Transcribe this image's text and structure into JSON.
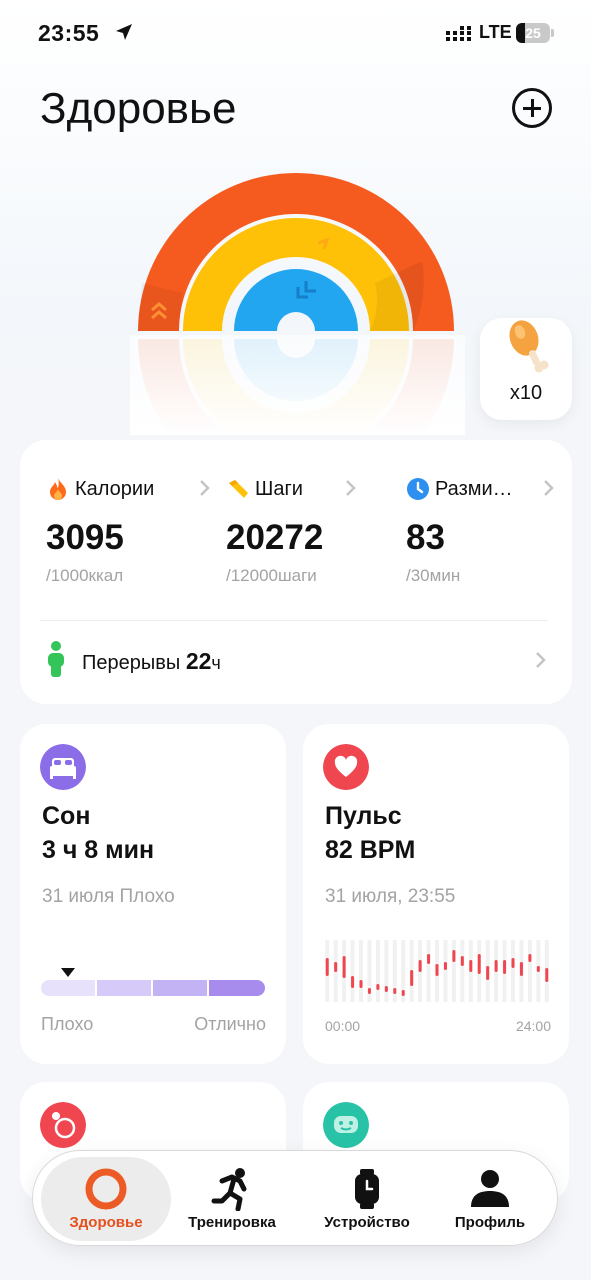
{
  "status_bar": {
    "time": "23:55",
    "network": "LTE",
    "battery": "25",
    "battery_level": 0.25
  },
  "page_title": "Здоровье",
  "rings": {
    "colors": {
      "outer": "#f55a1f",
      "middle": "#ffc107",
      "inner": "#23a6f0"
    }
  },
  "reward": {
    "count": "x10",
    "icon": "drumstick-icon"
  },
  "activity": {
    "metrics": [
      {
        "label": "Калории",
        "value": "3095",
        "goal": "/1000ккал",
        "icon": "flame-icon",
        "color": "#ff6a1a"
      },
      {
        "label": "Шаги",
        "value": "20272",
        "goal": "/12000шаги",
        "icon": "shoe-icon",
        "color": "#ffc107"
      },
      {
        "label": "Разми…",
        "value": "83",
        "goal": "/30мин",
        "icon": "clock-icon",
        "color": "#2d8ff0"
      }
    ],
    "breaks": {
      "label": "Перерывы",
      "value": "22",
      "unit": "ч",
      "icon": "person-icon",
      "color": "#33c45a"
    }
  },
  "sleep": {
    "title": "Сон",
    "value": "3 ч 8 мин",
    "subtitle": "31 июля Плохо",
    "scale_left": "Плохо",
    "scale_right": "Отлично",
    "icon": "bed-icon",
    "color": "#8b6de8",
    "rating_position": 0.12
  },
  "pulse": {
    "title": "Пульс",
    "value": "82 BPM",
    "subtitle": "31 июля, 23:55",
    "axis_start": "00:00",
    "axis_end": "24:00",
    "icon": "heart-icon",
    "color": "#ef4650"
  },
  "next_tiles": [
    {
      "icon": "o2-icon",
      "color": "#ef4650"
    },
    {
      "icon": "mood-icon",
      "color": "#28c3a6"
    }
  ],
  "tabbar": {
    "tabs": [
      {
        "label": "Здоровье",
        "icon": "health-ring-icon",
        "active": true
      },
      {
        "label": "Тренировка",
        "icon": "runner-icon",
        "active": false
      },
      {
        "label": "Устройство",
        "icon": "watch-icon",
        "active": false
      },
      {
        "label": "Профиль",
        "icon": "profile-icon",
        "active": false
      }
    ]
  }
}
